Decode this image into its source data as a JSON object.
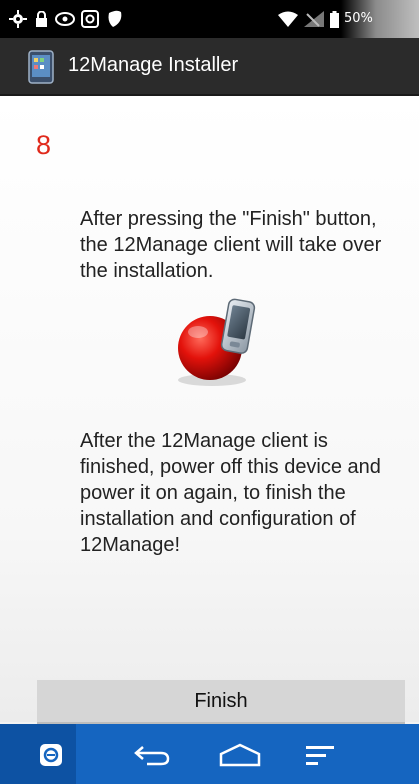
{
  "status_bar": {
    "battery_text": "50%",
    "icons": [
      "gear-icon",
      "lock-icon",
      "eye-icon",
      "remote-icon",
      "shield-icon",
      "wifi-icon",
      "no-signal-icon",
      "battery-icon"
    ]
  },
  "action_bar": {
    "title": "12Manage Installer",
    "icon": "app-tablet-icon"
  },
  "main": {
    "step_number": "8",
    "paragraph_1": "After pressing the \"Finish\" button, the 12Manage client will take over the installation.",
    "illustration": "red-ball-phone-icon",
    "paragraph_2": "After the 12Manage client is finished, power off this device and power it on again, to finish the installation and configuration of 12Manage!"
  },
  "buttons": {
    "finish_label": "Finish"
  },
  "nav_bar": {
    "icons": [
      "remote-app-icon",
      "back-icon",
      "home-icon",
      "recents-icon"
    ]
  },
  "colors": {
    "accent_red": "#e0291b",
    "nav_blue": "#1565c0",
    "action_bar": "#2b2b2b"
  }
}
